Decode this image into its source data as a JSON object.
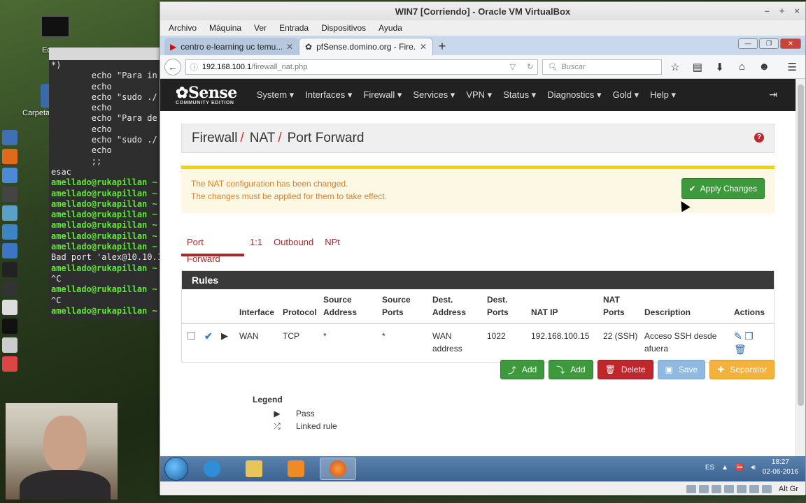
{
  "desktop": {
    "icon_labels": [
      "Ec",
      "Carpeta personal"
    ]
  },
  "terminal": {
    "lines": [
      {
        "text": "*)",
        "prompt": false
      },
      {
        "text": "        echo \"Para in",
        "prompt": false
      },
      {
        "text": "        echo",
        "prompt": false
      },
      {
        "text": "        echo \"sudo ./",
        "prompt": false
      },
      {
        "text": "        echo",
        "prompt": false
      },
      {
        "text": "        echo \"Para de",
        "prompt": false
      },
      {
        "text": "        echo",
        "prompt": false
      },
      {
        "text": "        echo \"sudo ./",
        "prompt": false
      },
      {
        "text": "        echo",
        "prompt": false
      },
      {
        "text": "        ;;",
        "prompt": false
      },
      {
        "text": "esac",
        "prompt": false
      },
      {
        "text": "amellado@rukapillan ~",
        "prompt": true
      },
      {
        "text": "amellado@rukapillan ~",
        "prompt": true
      },
      {
        "text": "amellado@rukapillan ~",
        "prompt": true
      },
      {
        "text": "amellado@rukapillan ~",
        "prompt": true
      },
      {
        "text": "amellado@rukapillan ~",
        "prompt": true
      },
      {
        "text": "amellado@rukapillan ~",
        "prompt": true
      },
      {
        "text": "amellado@rukapillan ~",
        "prompt": true
      },
      {
        "text": "Bad port 'alex@10.10.1",
        "prompt": false
      },
      {
        "text": "amellado@rukapillan ~",
        "prompt": true
      },
      {
        "text": "^C",
        "prompt": false
      },
      {
        "text": "amellado@rukapillan ~",
        "prompt": true
      },
      {
        "text": "^C",
        "prompt": false
      },
      {
        "text": "amellado@rukapillan ~",
        "prompt": true
      }
    ]
  },
  "vbox": {
    "title": "WIN7 [Corriendo] - Oracle VM VirtualBox",
    "menu": [
      "Archivo",
      "Máquina",
      "Ver",
      "Entrada",
      "Dispositivos",
      "Ayuda"
    ]
  },
  "browser": {
    "tabs": [
      {
        "title": "centro e-learning uc temu...",
        "active": false
      },
      {
        "title": "pfSense.domino.org - Fire...",
        "active": true
      }
    ],
    "url_host": "192.168.100.1",
    "url_path": "/firewall_nat.php",
    "search_placeholder": "Buscar"
  },
  "pfsense": {
    "logo_main": "Sense",
    "logo_sub": "COMMUNITY EDITION",
    "menu": [
      "System ▾",
      "Interfaces ▾",
      "Firewall ▾",
      "Services ▾",
      "VPN ▾",
      "Status ▾",
      "Diagnostics ▾",
      "Gold ▾",
      "Help ▾"
    ],
    "breadcrumb": [
      "Firewall",
      "NAT",
      "Port Forward"
    ],
    "alert": {
      "line1": "The NAT configuration has been changed.",
      "line2": "The changes must be applied for them to take effect.",
      "button": "Apply Changes"
    },
    "tabs": [
      "Port Forward",
      "1:1",
      "Outbound",
      "NPt"
    ],
    "rules_title": "Rules",
    "columns": [
      "",
      "",
      "",
      "Interface",
      "Protocol",
      "Source Address",
      "Source Ports",
      "Dest. Address",
      "Dest. Ports",
      "NAT IP",
      "NAT Ports",
      "Description",
      "Actions"
    ],
    "rows": [
      {
        "interface": "WAN",
        "protocol": "TCP",
        "source_address": "*",
        "source_ports": "*",
        "dest_address": "WAN address",
        "dest_ports": "1022",
        "nat_ip": "192.168.100.15",
        "nat_ports": "22 (SSH)",
        "description": "Acceso SSH desde afuera"
      }
    ],
    "buttons": {
      "add_top": "Add",
      "add_bottom": "Add",
      "delete": "Delete",
      "save": "Save",
      "separator": "Separator"
    },
    "legend": {
      "title": "Legend",
      "pass": "Pass",
      "linked": "Linked rule"
    }
  },
  "taskbar": {
    "language": "ES",
    "time": "18:27",
    "date": "02-06-2016",
    "altgr": "Alt Gr"
  },
  "colors": {
    "pf_red": "#a52a2a",
    "apply_green": "#3c9a3c",
    "delete_red": "#c0262c",
    "alert_bg": "#fcf8e3"
  }
}
